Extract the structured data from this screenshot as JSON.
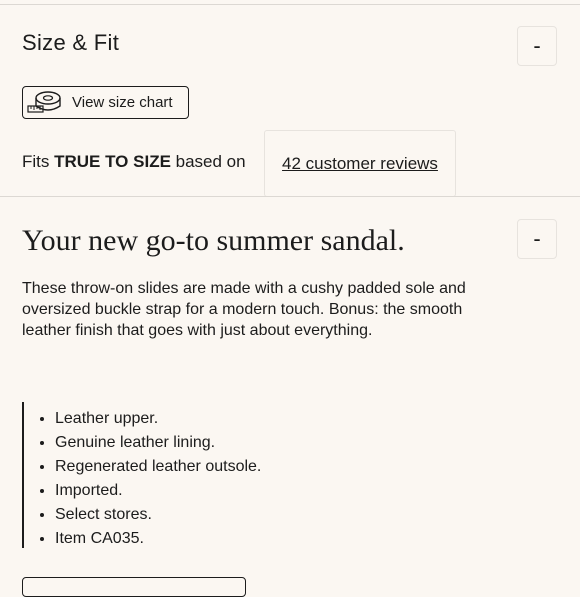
{
  "size_fit": {
    "title": "Size & Fit",
    "toggle_symbol": "-",
    "size_chart_label": "View size chart",
    "size_chart_icon": "tape-measure-icon",
    "fits_prefix": "Fits ",
    "fits_emphasis": "TRUE TO SIZE",
    "fits_suffix": " based on",
    "reviews_link": "42 customer reviews"
  },
  "description": {
    "headline": "Your new go-to summer sandal.",
    "toggle_symbol": "-",
    "body": "These throw-on slides are made with a cushy padded sole and oversized buckle strap for a modern touch. Bonus: the smooth leather finish that goes with just about everything.",
    "features": [
      "Leather upper.",
      "Genuine leather lining.",
      "Regenerated leather outsole.",
      "Imported.",
      "Select stores.",
      "Item CA035."
    ]
  }
}
